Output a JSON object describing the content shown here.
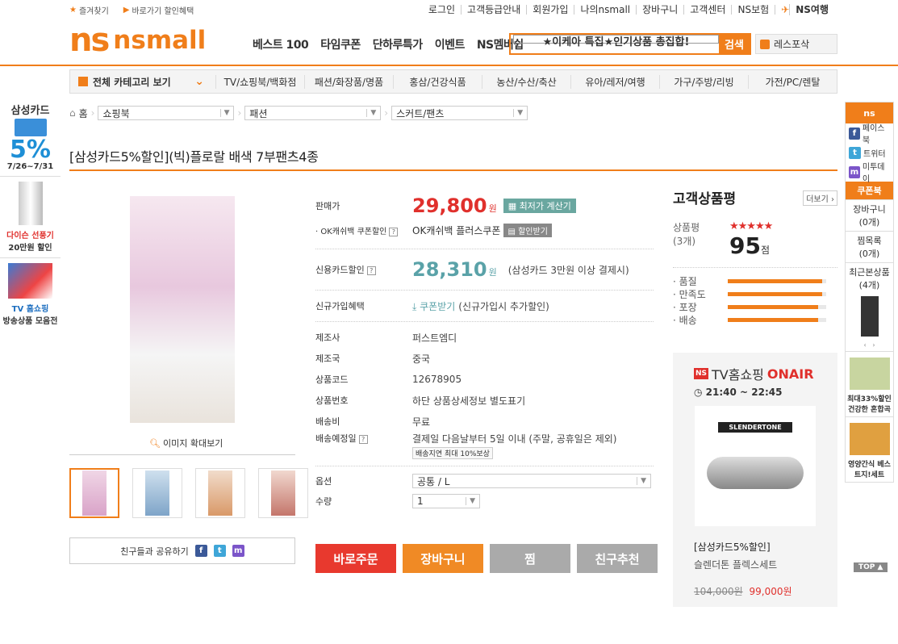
{
  "util_left": [
    "즐겨찾기",
    "바로가기 할인혜택"
  ],
  "util_right": [
    "로그인",
    "고객등급안내",
    "회원가입",
    "나의nsmall",
    "장바구니",
    "고객센터",
    "NS보험",
    "NS여행"
  ],
  "logo": {
    "mark": "ns",
    "text": "nsmall"
  },
  "gnb": [
    "베스트 100",
    "타임쿠폰",
    "단하루특가",
    "이벤트",
    "NS멤버쉽"
  ],
  "search": {
    "value": "★이케아 특집★인기상품 총집합!",
    "button": "검색"
  },
  "rest": "레스포삭",
  "category": {
    "all": "전체 카테고리 보기",
    "items": [
      "TV/쇼핑북/백화점",
      "패션/화장품/명품",
      "홍삼/건강식품",
      "농산/수산/축산",
      "유아/레저/여행",
      "가구/주방/리빙",
      "가전/PC/렌탈"
    ]
  },
  "left_banner": {
    "card": "삼성카드",
    "pct": "5%",
    "date": "7/26~7/31",
    "b1_red": "다이슨 선풍기",
    "b1": "20만원 할인",
    "b2_blue": "TV 홈쇼핑",
    "b2": "방송상품 모음전"
  },
  "breadcrumb": {
    "home": "홈",
    "c1": "쇼핑북",
    "c2": "패션",
    "c3": "스커트/팬츠"
  },
  "title": "[삼성카드5%할인](빅)플로랄 배색 7부팬츠4종",
  "zoom": "이미지 확대보기",
  "share": "친구들과 공유하기",
  "info": {
    "price_label": "판매가",
    "price": "29,800",
    "won": "원",
    "calc": "최저가 계산기",
    "ok_label": "· OK캐쉬백 쿠폰할인",
    "ok_val": "OK캐쉬백 플러스쿠폰",
    "ok_btn": "할인받기",
    "card_label": "신용카드할인",
    "card_price": "28,310",
    "card_note": "(삼성카드 3만원 이상 결제시)",
    "new_label": "신규가입혜택",
    "coupon": "쿠폰받기",
    "coupon_note": "(신규가입시 추가할인)",
    "specs": [
      {
        "k": "제조사",
        "v": "퍼스트엠디"
      },
      {
        "k": "제조국",
        "v": "중국"
      },
      {
        "k": "상품코드",
        "v": "12678905"
      },
      {
        "k": "상품번호",
        "v": "하단 상품상세정보 별도표기"
      },
      {
        "k": "배송비",
        "v": "무료"
      },
      {
        "k": "배송예정일",
        "v": "결제일 다음날부터 5일 이내 (주말, 공휴일은 제외)"
      }
    ],
    "delay": "배송지연 최대 10%보상",
    "opt_label": "옵션",
    "opt_val": "공통 / L",
    "qty_label": "수량",
    "qty_val": "1"
  },
  "buttons": [
    "바로주문",
    "장바구니",
    "찜",
    "친구추천"
  ],
  "review": {
    "title": "고객상품평",
    "more": "더보기",
    "score_label": "상품평",
    "count": "(3개)",
    "score": "95",
    "unit": "점",
    "stars": "★★★★★",
    "bars": [
      {
        "k": "· 품질",
        "v": 0.96
      },
      {
        "k": "· 만족도",
        "v": 0.96
      },
      {
        "k": "· 포장",
        "v": 0.92
      },
      {
        "k": "· 배송",
        "v": 0.92
      }
    ]
  },
  "tv": {
    "ns": "NS",
    "title": "TV홈쇼핑",
    "onair": "ONAIR",
    "time": "21:40 ~ 22:45",
    "name1": "[삼성카드5%할인]",
    "name2": "슬렌더톤 플렉스세트",
    "old": "104,000원",
    "new": "99,000원",
    "brand": "SLENDERTONE"
  },
  "right_side": {
    "sns": [
      "페이스북",
      "트위터",
      "미투데이"
    ],
    "coupon": "쿠폰북",
    "cart": "장바구니",
    "cart_n": "(0개)",
    "wish": "찜목록",
    "wish_n": "(0개)",
    "recent": "최근본상품",
    "recent_n": "(4개)",
    "ad1": "최대33%할인 건강한 혼합곡",
    "ad2": "영양간식 베스트지!세트",
    "top": "TOP"
  },
  "colors": {
    "brand": "#f07e1a",
    "price": "#e0302c",
    "card": "#5aa2a8"
  }
}
